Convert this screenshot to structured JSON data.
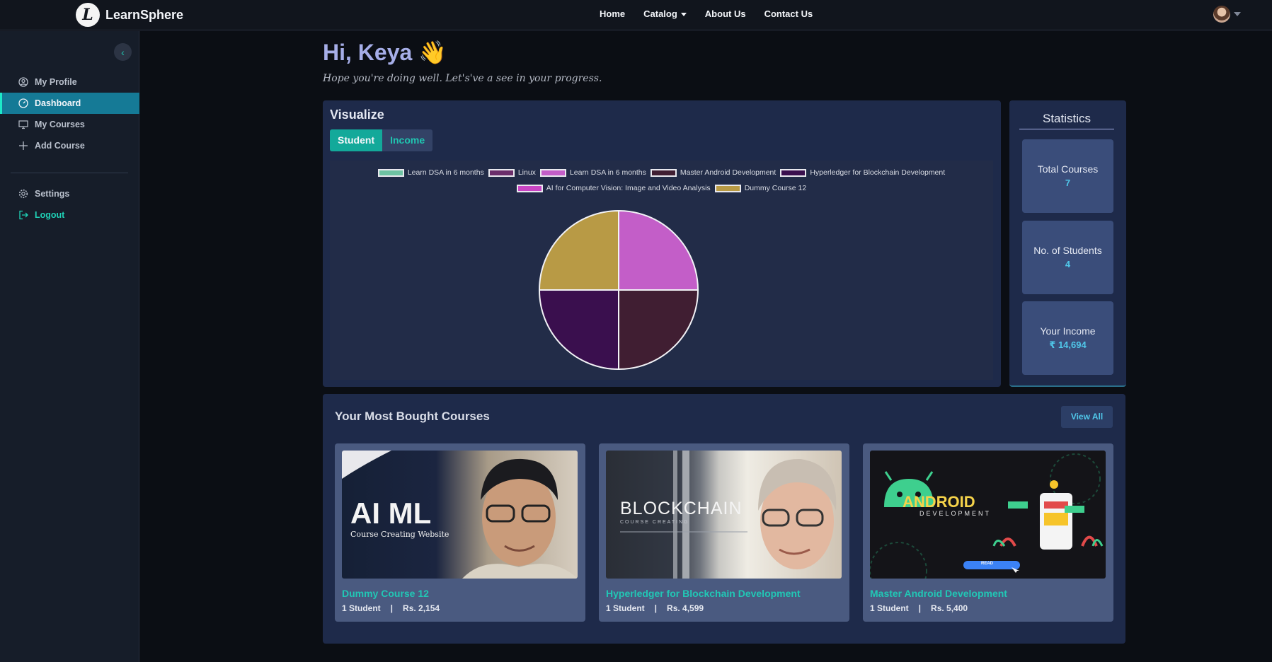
{
  "brand": {
    "name": "LearnSphere",
    "logo_letter": "L"
  },
  "nav": {
    "home": "Home",
    "catalog": "Catalog",
    "about": "About Us",
    "contact": "Contact Us"
  },
  "sidebar": {
    "items": [
      {
        "label": "My Profile"
      },
      {
        "label": "Dashboard"
      },
      {
        "label": "My Courses"
      },
      {
        "label": "Add Course"
      }
    ],
    "settings": "Settings",
    "logout": "Logout"
  },
  "greeting": {
    "title": "Hi, Keya 👋",
    "subtitle": "Hope you're doing well. Let's've a see in your progress."
  },
  "visualize": {
    "title": "Visualize",
    "tabs": [
      "Student",
      "Income"
    ],
    "active_tab": "Student"
  },
  "chart_data": {
    "type": "pie",
    "title": "",
    "categories": [
      "Learn DSA in 6 months",
      "Linux",
      "Learn DSA in 6 months",
      "Master Android Development",
      "Hyperledger for Blockchain Development",
      "AI for Computer Vision: Image and Video Analysis",
      "Dummy Course 12"
    ],
    "values": [
      0,
      0,
      1,
      1,
      1,
      0,
      1
    ],
    "colors": [
      "#6ec3a3",
      "#6b2e6b",
      "#c35ec8",
      "#401e32",
      "#3a0f4e",
      "#c945c4",
      "#b89a45"
    ],
    "legend_position": "top"
  },
  "statistics": {
    "title": "Statistics",
    "cards": [
      {
        "label": "Total Courses",
        "value": "7"
      },
      {
        "label": "No. of Students",
        "value": "4"
      },
      {
        "label": "Your Income",
        "value": "₹ 14,694"
      }
    ]
  },
  "courses": {
    "title": "Your Most Bought Courses",
    "view_all": "View All",
    "items": [
      {
        "name": "Dummy Course 12",
        "students": "1 Student",
        "price": "Rs. 2,154",
        "thumb_title": "AI  ML",
        "thumb_sub": "Course Creating Website"
      },
      {
        "name": "Hyperledger for Blockchain Development",
        "students": "1 Student",
        "price": "Rs. 4,599",
        "thumb_title": "BLOCKCHAIN",
        "thumb_sub": "COURSE CREATING"
      },
      {
        "name": "Master Android Development",
        "students": "1 Student",
        "price": "Rs. 5,400",
        "thumb_title": "ANDROID",
        "thumb_sub": "DEVELOPMENT",
        "thumb_btn": "READ"
      }
    ]
  }
}
